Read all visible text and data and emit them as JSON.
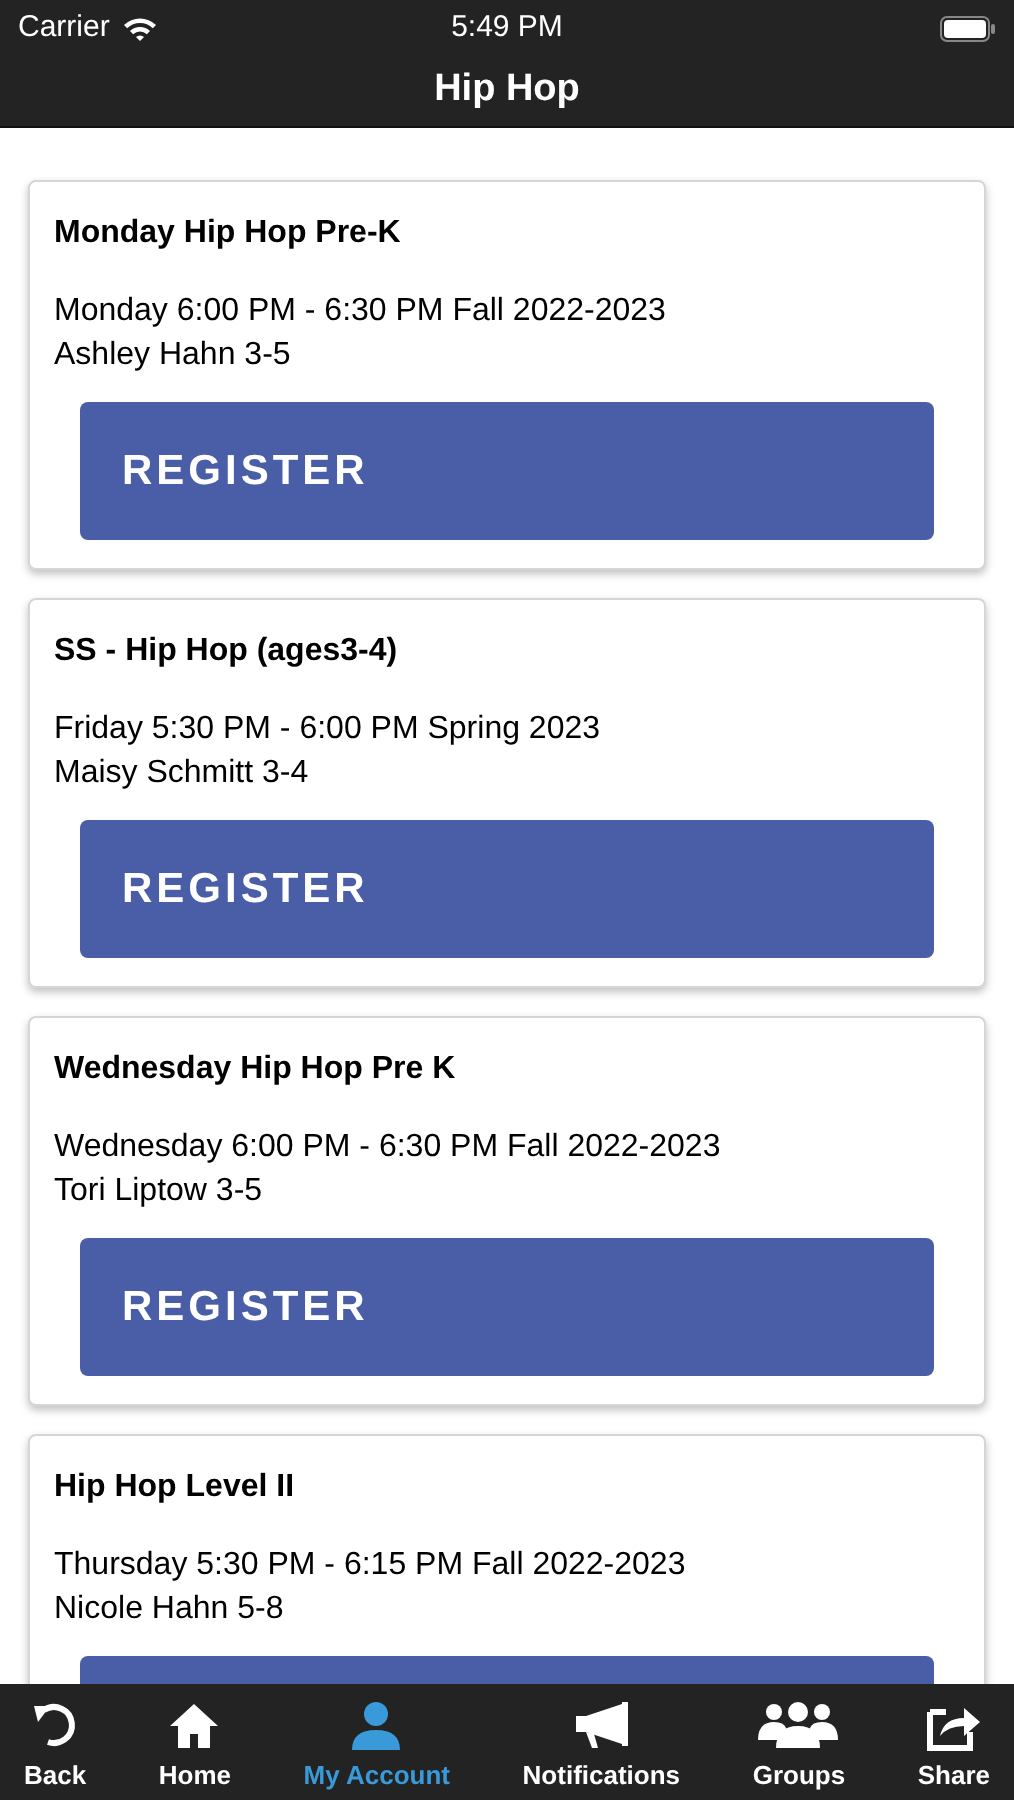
{
  "status_bar": {
    "carrier": "Carrier",
    "time": "5:49 PM"
  },
  "nav_bar": {
    "title": "Hip Hop"
  },
  "classes": [
    {
      "title": "Monday Hip Hop Pre-K",
      "schedule": "Monday 6:00 PM - 6:30 PM Fall 2022-2023",
      "teacher": "Ashley Hahn 3-5",
      "button": "REGISTER"
    },
    {
      "title": "SS - Hip Hop (ages3-4)",
      "schedule": "Friday 5:30 PM - 6:00 PM Spring 2023",
      "teacher": "Maisy Schmitt 3-4",
      "button": "REGISTER"
    },
    {
      "title": "Wednesday Hip Hop Pre K",
      "schedule": "Wednesday 6:00 PM - 6:30 PM Fall 2022-2023",
      "teacher": "Tori Liptow 3-5",
      "button": "REGISTER"
    },
    {
      "title": "Hip Hop Level II",
      "schedule": "Thursday 5:30 PM - 6:15 PM Fall 2022-2023",
      "teacher": "Nicole Hahn 5-8"
    }
  ],
  "tab_bar": [
    {
      "kind": "back",
      "label": "Back",
      "selected": false
    },
    {
      "kind": "home",
      "label": "Home",
      "selected": false
    },
    {
      "kind": "account",
      "label": "My Account",
      "selected": true
    },
    {
      "kind": "notifications",
      "label": "Notifications",
      "selected": false
    },
    {
      "kind": "groups",
      "label": "Groups",
      "selected": false
    },
    {
      "kind": "share",
      "label": "Share",
      "selected": false
    }
  ]
}
